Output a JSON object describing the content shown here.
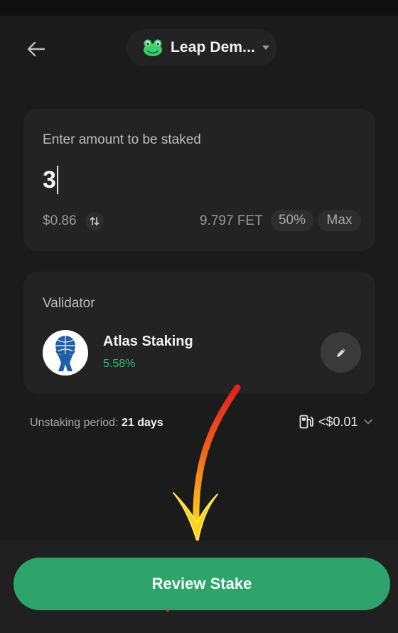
{
  "header": {
    "back_icon": "arrow-left-icon",
    "wallet_name": "Leap Dem...",
    "wallet_icon": "frog-icon",
    "caret_icon": "caret-down-icon"
  },
  "amount": {
    "label": "Enter amount to be staked",
    "value": "3",
    "usd_value": "$0.86",
    "swap_icon": "swap-vertical-icon",
    "balance": "9.797 FET",
    "pct_50_label": "50%",
    "max_label": "Max"
  },
  "validator": {
    "label": "Validator",
    "name": "Atlas Staking",
    "apr": "5.58%",
    "avatar_icon": "atlas-logo",
    "edit_icon": "pencil-icon"
  },
  "footer_info": {
    "unstaking_label": "Unstaking period:",
    "unstaking_value": "21 days",
    "fee_icon": "gas-pump-icon",
    "fee_value": "<$0.01",
    "fee_chevron": "chevron-down-icon"
  },
  "cta": {
    "label": "Review Stake"
  },
  "colors": {
    "background": "#1b1b1b",
    "card": "#232323",
    "accent_green": "#2ea46c",
    "apr_green": "#2fbe7b"
  }
}
